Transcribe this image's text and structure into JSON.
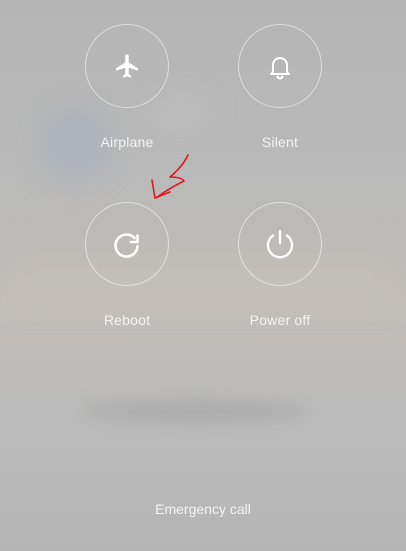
{
  "power_menu": {
    "airplane": {
      "label": "Airplane",
      "icon": "airplane-icon"
    },
    "silent": {
      "label": "Silent",
      "icon": "bell-icon"
    },
    "reboot": {
      "label": "Reboot",
      "icon": "reboot-icon"
    },
    "power_off": {
      "label": "Power off",
      "icon": "power-icon"
    },
    "emergency_call": {
      "label": "Emergency call"
    }
  },
  "colors": {
    "icon": "#ffffff",
    "annotation_arrow": "#e0191f"
  }
}
